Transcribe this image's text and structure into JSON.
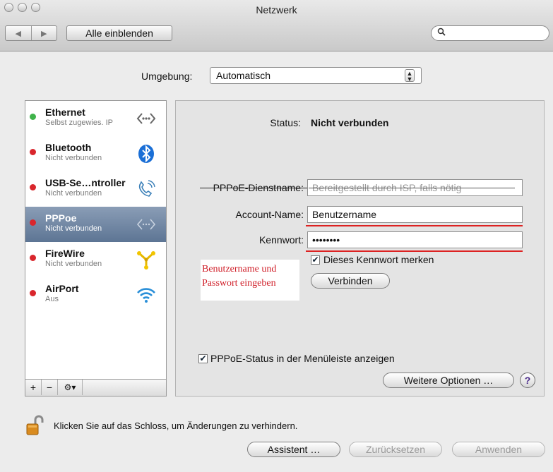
{
  "window": {
    "title": "Netzwerk"
  },
  "toolbar": {
    "show_all_label": "Alle einblenden",
    "search_value": "",
    "back_glyph": "◀",
    "forward_glyph": "▶"
  },
  "location": {
    "label": "Umgebung:",
    "value": "Automatisch"
  },
  "services": [
    {
      "name": "Ethernet",
      "status": "Selbst zugewies. IP",
      "indicator": "green",
      "icon": "ethernet-icon",
      "selected": false
    },
    {
      "name": "Bluetooth",
      "status": "Nicht verbunden",
      "indicator": "red",
      "icon": "bluetooth-icon",
      "selected": false
    },
    {
      "name": "USB-Se…ntroller",
      "status": "Nicht verbunden",
      "indicator": "red",
      "icon": "phone-modem-icon",
      "selected": false
    },
    {
      "name": "PPPoe",
      "status": "Nicht verbunden",
      "indicator": "red",
      "icon": "pppoe-icon",
      "selected": true
    },
    {
      "name": "FireWire",
      "status": "Nicht verbunden",
      "indicator": "red",
      "icon": "firewire-icon",
      "selected": false
    },
    {
      "name": "AirPort",
      "status": "Aus",
      "indicator": "red",
      "icon": "airport-icon",
      "selected": false
    }
  ],
  "sidebar_buttons": {
    "add": "+",
    "remove": "−",
    "action": "⚙▾"
  },
  "detail": {
    "status_label": "Status:",
    "status_value": "Nicht verbunden",
    "service_name_label": "PPPoE-Dienstname:",
    "service_name_placeholder": "Bereitgestellt durch ISP, falls nötig",
    "account_label": "Account-Name:",
    "account_value": "Benutzername",
    "password_label": "Kennwort:",
    "password_value": "••••••••",
    "remember_label": "Dieses Kennwort merken",
    "remember_checked": true,
    "connect_label": "Verbinden",
    "annotation_line1": "Benutzername und",
    "annotation_line2": "Passwort eingeben",
    "menubar_label": "PPPoE-Status in der Menüleiste anzeigen",
    "menubar_checked": true,
    "more_options_label": "Weitere Optionen …",
    "help_label": "?"
  },
  "footer": {
    "lock_text": "Klicken Sie auf das Schloss, um Änderungen zu verhindern.",
    "assistant_label": "Assistent …",
    "revert_label": "Zurücksetzen",
    "apply_label": "Anwenden"
  },
  "colors": {
    "indicator_green": "#3fb34a",
    "indicator_red": "#d9262c",
    "selection": "#6b82a0",
    "annotation_red": "#d0202a"
  }
}
